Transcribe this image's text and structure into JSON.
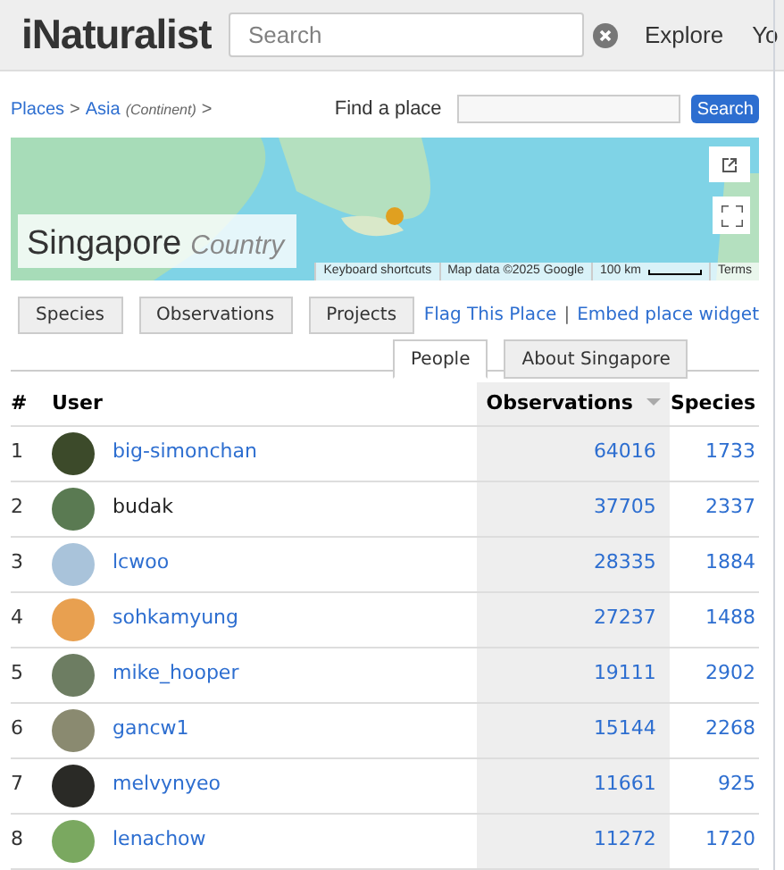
{
  "header": {
    "logo": "iNaturalist",
    "search": {
      "placeholder": "Search"
    },
    "nav": [
      "Explore",
      "Yo"
    ]
  },
  "breadcrumb": {
    "links": [
      "Places",
      "Asia"
    ],
    "separator": ">",
    "type": "(Continent)",
    "trail": ">"
  },
  "find_place": {
    "label": "Find a place",
    "button": "Search"
  },
  "map": {
    "place_name": "Singapore",
    "place_type": "Country",
    "attribution": [
      "Keyboard shortcuts",
      "Map data ©2025 Google",
      "100 km",
      "Terms"
    ]
  },
  "tabs_top": [
    {
      "label": "Species",
      "selected": false
    },
    {
      "label": "Observations",
      "selected": false
    },
    {
      "label": "Projects",
      "selected": false
    }
  ],
  "links": [
    "Flag This Place",
    "Embed place widget"
  ],
  "links_separator": "|",
  "tabs_bottom": [
    {
      "label": "People",
      "selected": true
    },
    {
      "label": "About Singapore",
      "selected": false
    }
  ],
  "table": {
    "columns": [
      "#",
      "User",
      "Observations",
      "Species"
    ],
    "rows": [
      {
        "rank": "1",
        "user": "big-simonchan",
        "linked": true,
        "observations": "64016",
        "species": "1733"
      },
      {
        "rank": "2",
        "user": "budak",
        "linked": false,
        "observations": "37705",
        "species": "2337"
      },
      {
        "rank": "3",
        "user": "lcwoo",
        "linked": true,
        "observations": "28335",
        "species": "1884"
      },
      {
        "rank": "4",
        "user": "sohkamyung",
        "linked": true,
        "observations": "27237",
        "species": "1488"
      },
      {
        "rank": "5",
        "user": "mike_hooper",
        "linked": true,
        "observations": "19111",
        "species": "2902"
      },
      {
        "rank": "6",
        "user": "gancw1",
        "linked": true,
        "observations": "15144",
        "species": "2268"
      },
      {
        "rank": "7",
        "user": "melvynyeo",
        "linked": true,
        "observations": "11661",
        "species": "925"
      },
      {
        "rank": "8",
        "user": "lenachow",
        "linked": true,
        "observations": "11272",
        "species": "1720"
      }
    ]
  }
}
